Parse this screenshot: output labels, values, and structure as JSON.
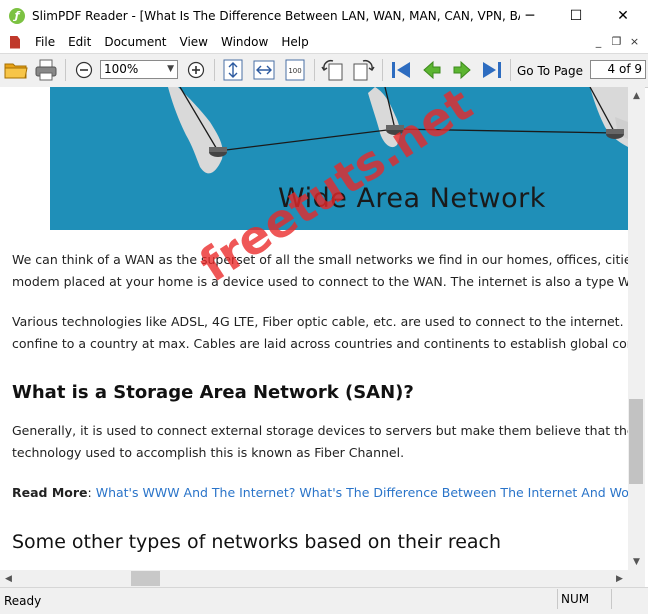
{
  "window": {
    "title": "SlimPDF Reader - [What Is The Difference Between LAN, WAN, MAN, CAN, VPN, BAN, N...",
    "minimize": "─",
    "maximize": "☐",
    "close": "✕"
  },
  "menu": {
    "items": [
      "File",
      "Edit",
      "Document",
      "View",
      "Window",
      "Help"
    ],
    "doc_minimize": "_",
    "doc_restore": "❐",
    "doc_close": "×"
  },
  "toolbar": {
    "zoom_value": "100%",
    "goto_label": "Go To Page",
    "page_indicator": "4 of 9"
  },
  "document": {
    "banner_caption": "Wide Area Network",
    "para1_line1": "We can think of a WAN as the superset of all the small networks we find in our homes, offices, cities, states, and co",
    "para1_line2": "modem placed at your home is a device used to connect to the WAN. The internet is also a type WAN that spans ac",
    "para2_line1": "Various technologies like ADSL, 4G LTE, Fiber optic cable, etc. are used to connect to the internet. However, these t",
    "para2_line2": "confine to a country at max. Cables are laid across countries and continents to establish global connectivity.",
    "heading_san": "What is a Storage Area Network (SAN)?",
    "para3_line1": "Generally, it is used to connect external storage devices to servers but make them believe that the storage is attach",
    "para3_line2": "technology used to accomplish this is known as Fiber Channel.",
    "read_more_label": "Read More",
    "read_more_sep": ": ",
    "read_more_link": "What's WWW And The Internet? What's The Difference Between The Internet And World Wide Web?",
    "heading_other": "Some other types of networks based on their reach",
    "watermark": "freetuts.net"
  },
  "status": {
    "ready": "Ready",
    "num": "NUM"
  },
  "colors": {
    "banner": "#1f8fb8",
    "link": "#2a74c9",
    "watermark": "#eb2828"
  }
}
